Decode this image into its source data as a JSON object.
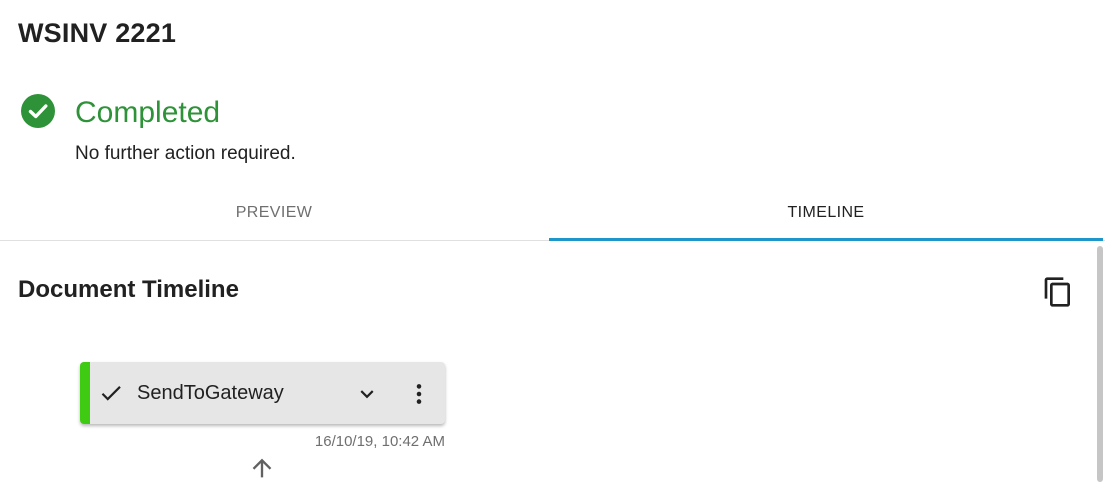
{
  "document": {
    "title": "WSINV 2221"
  },
  "status": {
    "icon": "check-circle-icon",
    "title": "Completed",
    "subtitle": "No further action required.",
    "color": "#2e9238"
  },
  "tabs": [
    {
      "label": "PREVIEW",
      "active": false
    },
    {
      "label": "TIMELINE",
      "active": true
    }
  ],
  "colors": {
    "tab_indicator": "#1e96c8",
    "event_status_bar": "#3ecb12"
  },
  "timeline": {
    "title": "Document Timeline",
    "copy_icon": "copy-icon",
    "events": [
      {
        "name": "SendToGateway",
        "status_icon": "check-icon",
        "expand_icon": "chevron-down-icon",
        "menu_icon": "more-vert-icon",
        "timestamp": "16/10/19, 10:42 AM"
      }
    ],
    "connector_icon": "arrow-up-icon"
  }
}
